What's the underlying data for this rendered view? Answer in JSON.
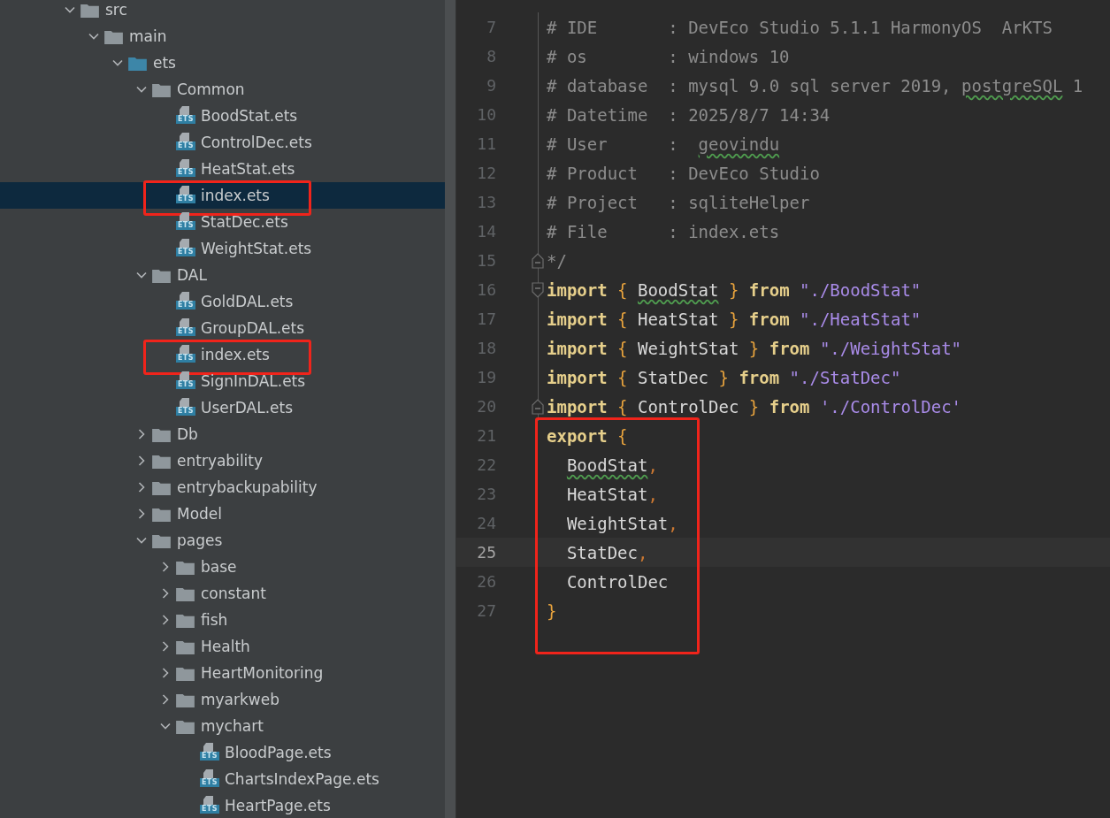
{
  "project_tree": {
    "items": [
      {
        "label": "src",
        "kind": "folder",
        "expanded": true,
        "selected": false,
        "children": [
          {
            "label": "main",
            "kind": "folder",
            "expanded": true,
            "selected": false,
            "children": [
              {
                "label": "ets",
                "kind": "source_folder",
                "expanded": true,
                "selected": false,
                "children": [
                  {
                    "label": "Common",
                    "kind": "folder",
                    "expanded": true,
                    "selected": false,
                    "children": [
                      {
                        "label": "BoodStat.ets",
                        "kind": "file",
                        "icon_label": "ETS",
                        "selected": false
                      },
                      {
                        "label": "ControlDec.ets",
                        "kind": "file",
                        "icon_label": "ETS",
                        "selected": false
                      },
                      {
                        "label": "HeatStat.ets",
                        "kind": "file",
                        "icon_label": "ETS",
                        "selected": false
                      },
                      {
                        "label": "index.ets",
                        "kind": "file",
                        "icon_label": "ETS",
                        "selected": true,
                        "boxed": true
                      },
                      {
                        "label": "StatDec.ets",
                        "kind": "file",
                        "icon_label": "ETS",
                        "selected": false
                      },
                      {
                        "label": "WeightStat.ets",
                        "kind": "file",
                        "icon_label": "ETS",
                        "selected": false
                      }
                    ]
                  },
                  {
                    "label": "DAL",
                    "kind": "folder",
                    "expanded": true,
                    "selected": false,
                    "children": [
                      {
                        "label": "GoldDAL.ets",
                        "kind": "file",
                        "icon_label": "ETS",
                        "selected": false
                      },
                      {
                        "label": "GroupDAL.ets",
                        "kind": "file",
                        "icon_label": "ETS",
                        "selected": false
                      },
                      {
                        "label": "index.ets",
                        "kind": "file",
                        "icon_label": "ETS",
                        "selected": false,
                        "boxed": true
                      },
                      {
                        "label": "SignInDAL.ets",
                        "kind": "file",
                        "icon_label": "ETS",
                        "selected": false
                      },
                      {
                        "label": "UserDAL.ets",
                        "kind": "file",
                        "icon_label": "ETS",
                        "selected": false
                      }
                    ]
                  },
                  {
                    "label": "Db",
                    "kind": "folder",
                    "expanded": false,
                    "selected": false
                  },
                  {
                    "label": "entryability",
                    "kind": "folder",
                    "expanded": false,
                    "selected": false
                  },
                  {
                    "label": "entrybackupability",
                    "kind": "folder",
                    "expanded": false,
                    "selected": false
                  },
                  {
                    "label": "Model",
                    "kind": "folder",
                    "expanded": false,
                    "selected": false
                  },
                  {
                    "label": "pages",
                    "kind": "folder",
                    "expanded": true,
                    "selected": false,
                    "children": [
                      {
                        "label": "base",
                        "kind": "folder",
                        "expanded": false,
                        "selected": false
                      },
                      {
                        "label": "constant",
                        "kind": "folder",
                        "expanded": false,
                        "selected": false
                      },
                      {
                        "label": "fish",
                        "kind": "folder",
                        "expanded": false,
                        "selected": false
                      },
                      {
                        "label": "Health",
                        "kind": "folder",
                        "expanded": false,
                        "selected": false
                      },
                      {
                        "label": "HeartMonitoring",
                        "kind": "folder",
                        "expanded": false,
                        "selected": false
                      },
                      {
                        "label": "myarkweb",
                        "kind": "folder",
                        "expanded": false,
                        "selected": false
                      },
                      {
                        "label": "mychart",
                        "kind": "folder",
                        "expanded": true,
                        "selected": false,
                        "children": [
                          {
                            "label": "BloodPage.ets",
                            "kind": "file",
                            "icon_label": "ETS",
                            "selected": false
                          },
                          {
                            "label": "ChartsIndexPage.ets",
                            "kind": "file",
                            "icon_label": "ETS",
                            "selected": false
                          },
                          {
                            "label": "HeartPage.ets",
                            "kind": "file",
                            "icon_label": "ETS",
                            "selected": false
                          }
                        ]
                      }
                    ]
                  }
                ]
              }
            ]
          }
        ]
      }
    ]
  },
  "editor": {
    "lines": [
      {
        "number": "7",
        "current": false,
        "tokens": [
          {
            "kind": "comment",
            "text": "# IDE       : DevEco Studio 5.1.1 HarmonyOS  ArKTS"
          }
        ]
      },
      {
        "number": "8",
        "current": false,
        "tokens": [
          {
            "kind": "comment",
            "text": "# os        : windows 10"
          }
        ]
      },
      {
        "number": "9",
        "current": false,
        "tokens": [
          {
            "kind": "comment",
            "text": "# database  : mysql 9.0 sql server 2019, "
          },
          {
            "kind": "comment",
            "text": "postgreSQL",
            "typo": true
          },
          {
            "kind": "comment",
            "text": " 1"
          }
        ]
      },
      {
        "number": "10",
        "current": false,
        "tokens": [
          {
            "kind": "comment",
            "text": "# Datetime  : 2025/8/7 14:34"
          }
        ]
      },
      {
        "number": "11",
        "current": false,
        "tokens": [
          {
            "kind": "comment",
            "text": "# User      :  "
          },
          {
            "kind": "comment",
            "text": "geovindu",
            "typo": true
          }
        ]
      },
      {
        "number": "12",
        "current": false,
        "tokens": [
          {
            "kind": "comment",
            "text": "# Product   : DevEco Studio"
          }
        ]
      },
      {
        "number": "13",
        "current": false,
        "tokens": [
          {
            "kind": "comment",
            "text": "# Project   : sqliteHelper"
          }
        ]
      },
      {
        "number": "14",
        "current": false,
        "tokens": [
          {
            "kind": "comment",
            "text": "# File      : index.ets"
          }
        ]
      },
      {
        "number": "15",
        "current": false,
        "fold_end": true,
        "tokens": [
          {
            "kind": "comment",
            "text": "*/"
          }
        ]
      },
      {
        "number": "16",
        "current": false,
        "fold_start": true,
        "tokens": [
          {
            "kind": "keyword",
            "text": "import"
          },
          {
            "kind": "brace",
            "text": " { "
          },
          {
            "kind": "ident",
            "text": "BoodStat",
            "typo": true
          },
          {
            "kind": "brace",
            "text": " } "
          },
          {
            "kind": "keyword",
            "text": "from"
          },
          {
            "kind": "string",
            "text": " \"./BoodStat\""
          }
        ]
      },
      {
        "number": "17",
        "current": false,
        "tokens": [
          {
            "kind": "keyword",
            "text": "import"
          },
          {
            "kind": "brace",
            "text": " { "
          },
          {
            "kind": "ident",
            "text": "HeatStat"
          },
          {
            "kind": "brace",
            "text": " } "
          },
          {
            "kind": "keyword",
            "text": "from"
          },
          {
            "kind": "string",
            "text": " \"./HeatStat\""
          }
        ]
      },
      {
        "number": "18",
        "current": false,
        "tokens": [
          {
            "kind": "keyword",
            "text": "import"
          },
          {
            "kind": "brace",
            "text": " { "
          },
          {
            "kind": "ident",
            "text": "WeightStat"
          },
          {
            "kind": "brace",
            "text": " } "
          },
          {
            "kind": "keyword",
            "text": "from"
          },
          {
            "kind": "string",
            "text": " \"./WeightStat\""
          }
        ]
      },
      {
        "number": "19",
        "current": false,
        "tokens": [
          {
            "kind": "keyword",
            "text": "import"
          },
          {
            "kind": "brace",
            "text": " { "
          },
          {
            "kind": "ident",
            "text": "StatDec"
          },
          {
            "kind": "brace",
            "text": " } "
          },
          {
            "kind": "keyword",
            "text": "from"
          },
          {
            "kind": "string",
            "text": " \"./StatDec\""
          }
        ]
      },
      {
        "number": "20",
        "current": false,
        "fold_end": true,
        "tokens": [
          {
            "kind": "keyword",
            "text": "import"
          },
          {
            "kind": "brace",
            "text": " { "
          },
          {
            "kind": "ident",
            "text": "ControlDec"
          },
          {
            "kind": "brace",
            "text": " } "
          },
          {
            "kind": "keyword",
            "text": "from"
          },
          {
            "kind": "string",
            "text": " './ControlDec'"
          }
        ]
      }
    ],
    "highlighted_lines": [
      {
        "number": "21",
        "current": false,
        "tokens": [
          {
            "kind": "keyword",
            "text": "export"
          },
          {
            "kind": "brace",
            "text": " {"
          }
        ]
      },
      {
        "number": "22",
        "current": false,
        "indented": true,
        "tokens": [
          {
            "kind": "ident",
            "text": "BoodStat",
            "typo": true
          },
          {
            "kind": "punct",
            "text": ","
          }
        ]
      },
      {
        "number": "23",
        "current": false,
        "indented": true,
        "tokens": [
          {
            "kind": "ident",
            "text": "HeatStat"
          },
          {
            "kind": "punct",
            "text": ","
          }
        ]
      },
      {
        "number": "24",
        "current": false,
        "indented": true,
        "tokens": [
          {
            "kind": "ident",
            "text": "WeightStat"
          },
          {
            "kind": "punct",
            "text": ","
          }
        ]
      },
      {
        "number": "25",
        "current": true,
        "indented": true,
        "tokens": [
          {
            "kind": "ident",
            "text": "StatDec"
          },
          {
            "kind": "punct",
            "text": ","
          }
        ]
      },
      {
        "number": "26",
        "current": false,
        "indented": true,
        "tokens": [
          {
            "kind": "ident",
            "text": "ControlDec"
          }
        ]
      },
      {
        "number": "27",
        "current": false,
        "tokens": [
          {
            "kind": "brace",
            "text": "}"
          }
        ]
      }
    ]
  }
}
